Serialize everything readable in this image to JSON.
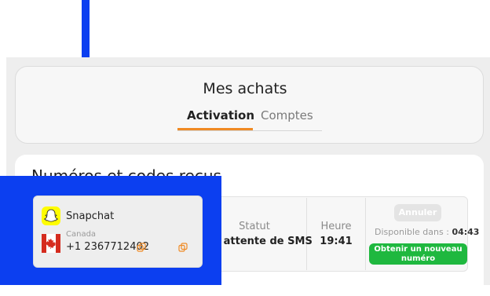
{
  "page": {
    "title": "Mes achats"
  },
  "tabs": [
    {
      "label": "Activation",
      "active": true
    },
    {
      "label": "Comptes",
      "active": false
    }
  ],
  "section": {
    "title": "Numéros et codes reçus"
  },
  "purchase": {
    "service": "Snapchat",
    "country": "Canada",
    "phone": "+1 2367712402",
    "status_label": "Statut",
    "status_value": "En attente de SMS",
    "time_label": "Heure",
    "time_value": "19:41",
    "cancel_label": "Annuler",
    "available_label": "Disponible dans :",
    "available_value": "04:43",
    "new_number_label": "Obtenir un nouveau numéro"
  },
  "colors": {
    "accent": "#f08a24",
    "success": "#1fb83f",
    "annotation": "#0c3ff0",
    "snapchat": "#fffc00"
  },
  "icons": [
    "annotation-arrow-icon",
    "snapchat-icon",
    "canada-flag-icon",
    "copy-icon"
  ]
}
